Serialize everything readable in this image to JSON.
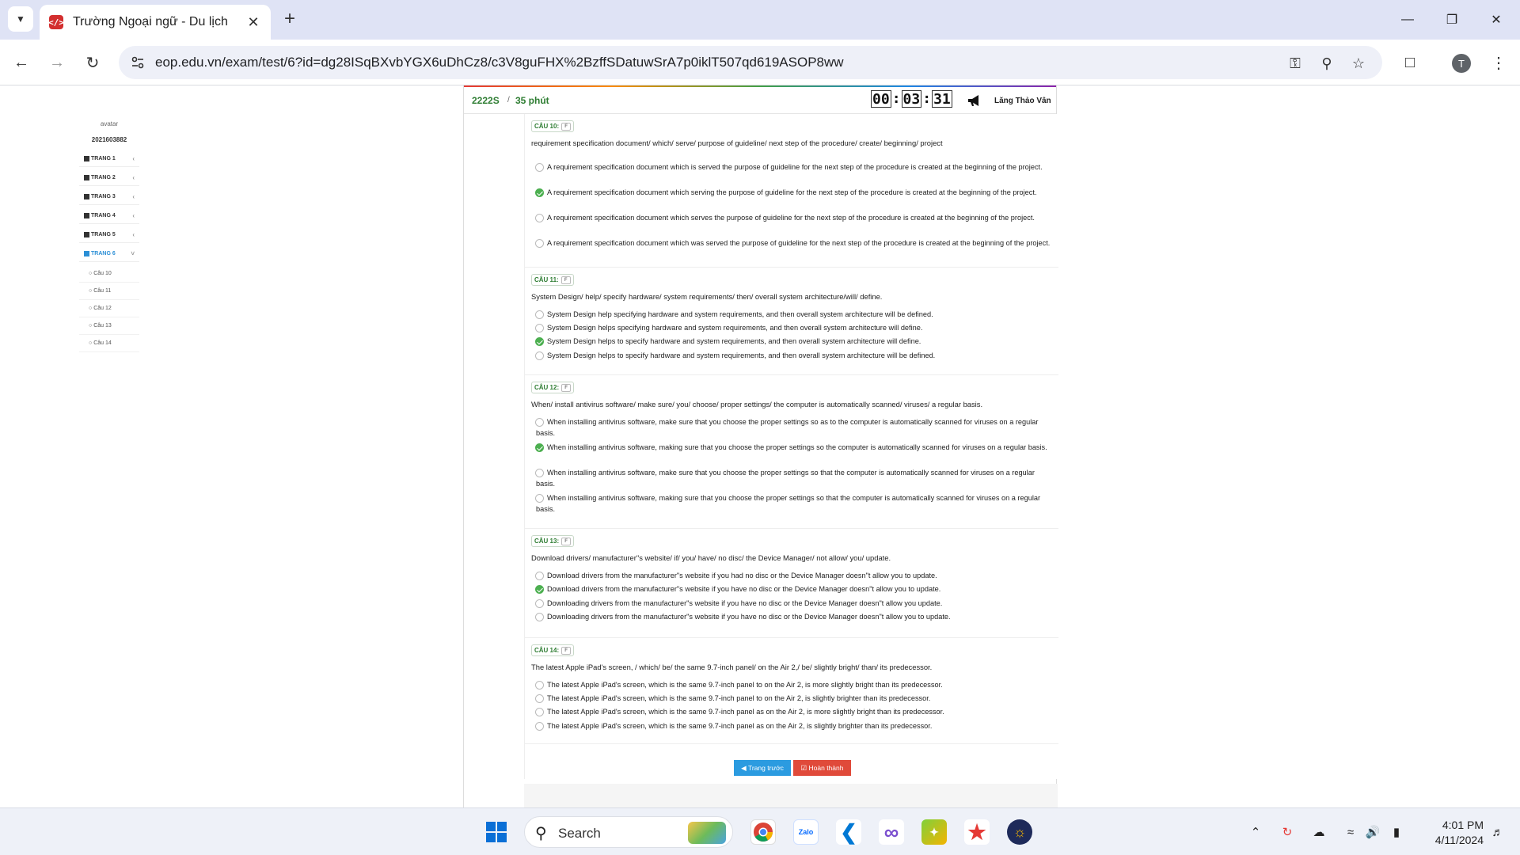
{
  "browser": {
    "tab_title": "Trường Ngoại ngữ - Du lịch",
    "url": "eop.edu.vn/exam/test/6?id=dg28ISqBXvbYGX6uDhCz8/c3V8guFHX%2BzffSDatuwSrA7p0iklT507qd619ASOP8ww",
    "profile_initial": "T"
  },
  "sidebar": {
    "avatar_alt": "avatar",
    "student_id": "2021603882",
    "pages": [
      {
        "label": "TRANG 1"
      },
      {
        "label": "TRANG 2"
      },
      {
        "label": "TRANG 3"
      },
      {
        "label": "TRANG 4"
      },
      {
        "label": "TRANG 5"
      },
      {
        "label": "TRANG 6"
      }
    ],
    "questions": [
      "Câu 10",
      "Câu 11",
      "Câu 12",
      "Câu 13",
      "Câu 14"
    ]
  },
  "exam": {
    "code": "2222S",
    "separator": "/",
    "duration": "35 phút",
    "timer": {
      "h": "00",
      "m": "03",
      "s": "31"
    },
    "student_name": "Lăng Thảo Vân",
    "flag_text": "F",
    "questions": [
      {
        "label": "CÂU 10:",
        "prompt": "requirement specification document/ which/ serve/ purpose of guideline/ next step of the procedure/ create/ beginning/ project",
        "selected": 1,
        "options": [
          "A requirement specification document which is served the purpose of guideline for the next step of the procedure is created at the beginning of the project.",
          "A requirement specification document which serving the purpose of guideline for the next step of the procedure is created at the beginning of the project.",
          "A requirement specification document which serves the purpose of guideline for the next step of the procedure is created at the beginning of the project.",
          "A requirement specification document which was served the purpose of guideline for the next step of the procedure is created at the beginning of the project."
        ]
      },
      {
        "label": "CÂU 11:",
        "prompt": "System Design/ help/ specify hardware/ system requirements/ then/ overall system architecture/will/ define.",
        "selected": 2,
        "options": [
          "System Design help specifying hardware and system requirements, and then overall system architecture will be defined.",
          "System Design helps specifying hardware and system requirements, and then overall system architecture will define.",
          "System Design helps to specify hardware and system requirements, and then overall system architecture will define.",
          "System Design helps to specify hardware and system requirements, and then overall system architecture will be defined."
        ]
      },
      {
        "label": "CÂU 12:",
        "prompt": "When/ install antivirus software/ make sure/ you/ choose/ proper settings/ the computer is automatically scanned/ viruses/ a regular basis.",
        "selected": 1,
        "options": [
          "When installing antivirus software, make sure that you choose the proper settings so as to the computer is automatically scanned for viruses on a regular basis.",
          "When installing antivirus software, making sure that you choose the proper settings so the computer is automatically scanned for viruses on a regular basis.",
          "When installing antivirus software, make sure that you choose the proper settings so that the computer is automatically scanned for viruses on a regular basis.",
          "When installing antivirus software, making sure that you choose the proper settings so that the computer is automatically scanned for viruses on a regular basis."
        ]
      },
      {
        "label": "CÂU 13:",
        "prompt": "Download drivers/ manufacturer\"s website/ if/ you/ have/ no disc/ the Device Manager/ not allow/ you/ update.",
        "selected": 1,
        "options": [
          "Download drivers from the manufacturer\"s website if you had no disc or the Device Manager doesn\"t allow you to update.",
          "Download drivers from the manufacturer\"s website if you have no disc or the Device Manager doesn\"t allow you to update.",
          "Downloading drivers from the manufacturer\"s website if you have no disc or the Device Manager doesn\"t allow you update.",
          "Downloading drivers from the manufacturer\"s website if you have no disc or the Device Manager doesn\"t allow you to update."
        ]
      },
      {
        "label": "CÂU 14:",
        "prompt": "The latest Apple iPad's screen, / which/ be/ the same 9.7-inch panel/ on the Air 2,/ be/ slightly bright/ than/ its predecessor.",
        "selected": -1,
        "options": [
          "The latest Apple iPad's screen, which is the same 9.7-inch panel to on the Air 2, is more slightly bright than its predecessor.",
          "The latest Apple iPad's screen, which is the same 9.7-inch panel to on the Air 2, is slightly brighter than its predecessor.",
          "The latest Apple iPad's screen, which is the same 9.7-inch panel as on the Air 2, is more slightly bright than its predecessor.",
          "The latest Apple iPad's screen, which is the same 9.7-inch panel as on the Air 2, is slightly brighter than its predecessor."
        ]
      }
    ],
    "prev_button": "Trang trước",
    "done_button": "Hoàn thành"
  },
  "taskbar": {
    "search_placeholder": "Search",
    "time": "4:01 PM",
    "date": "4/11/2024"
  },
  "colors": {
    "accent_green": "#4caf50",
    "prev_blue": "#2b9be0",
    "done_red": "#e04a3a"
  }
}
